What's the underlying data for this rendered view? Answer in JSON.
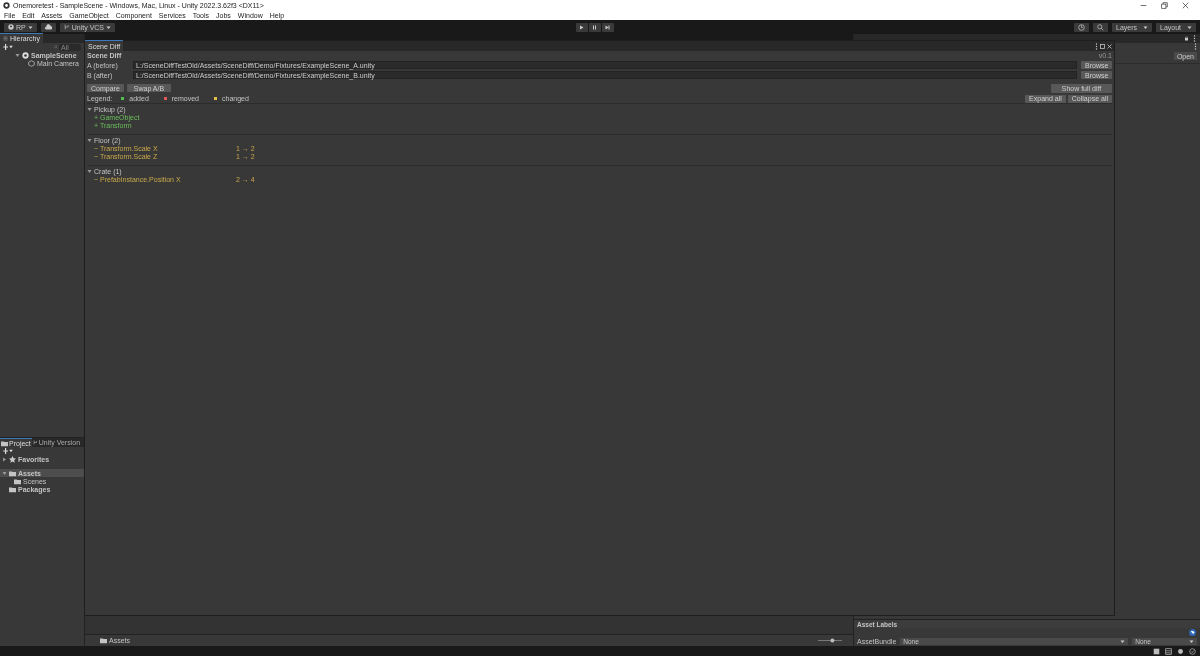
{
  "window": {
    "title": "Onemoretest - SampleScene - Windows, Mac, Linux - Unity 2022.3.62f3 <DX11>"
  },
  "menu": [
    "File",
    "Edit",
    "Assets",
    "GameObject",
    "Component",
    "Services",
    "Tools",
    "Jobs",
    "Window",
    "Help"
  ],
  "toolbar": {
    "account": "RP",
    "vcs": "Unity VCS",
    "layers": "Layers",
    "layout": "Layout"
  },
  "hierarchy": {
    "title": "Hierarchy",
    "search_placeholder": "All",
    "items": [
      {
        "label": "SampleScene",
        "expanded": true,
        "children": [
          {
            "label": "Main Camera"
          }
        ]
      }
    ]
  },
  "project": {
    "tabs": [
      {
        "label": "Project",
        "selected": true
      },
      {
        "label": "Unity Version",
        "selected": false
      }
    ],
    "tree": [
      {
        "label": "Favorites",
        "kind": "favorites",
        "expanded": false,
        "selected": false
      },
      {
        "label": "Assets",
        "kind": "folder",
        "expanded": true,
        "selected": true,
        "children": [
          {
            "label": "Scenes",
            "kind": "folder",
            "selected": false
          }
        ]
      },
      {
        "label": "Packages",
        "kind": "folder",
        "selected": false
      }
    ],
    "breadcrumb": "Assets",
    "zoom": {
      "level": 0.62
    }
  },
  "inspector": {
    "open_button": "Open",
    "asset_labels": "Asset Labels",
    "asset_bundle_label": "AssetBundle",
    "bundle": "None",
    "variant": "None"
  },
  "scene_diff": {
    "tab": "Scene Diff",
    "heading": "Scene Diff",
    "version": "v0.1",
    "paths": [
      {
        "label": "A (before)",
        "value": "L:/SceneDiffTestOld/Assets/SceneDiff/Demo/Fixtures/ExampleScene_A.unity",
        "button": "Browse"
      },
      {
        "label": "B (after)",
        "value": "L:/SceneDiffTestOld/Assets/SceneDiff/Demo/Fixtures/ExampleScene_B.unity",
        "button": "Browse"
      }
    ],
    "compare": "Compare",
    "swap": "Swap A/B",
    "show_full_diff": "Show full diff",
    "expand_all": "Expand all",
    "collapse_all": "Collapse all",
    "legend": {
      "label": "Legend:",
      "items": [
        {
          "label": "added",
          "color": "#4fbf4f"
        },
        {
          "label": "removed",
          "color": "#e05858"
        },
        {
          "label": "changed",
          "color": "#e0c040"
        }
      ]
    },
    "groups": [
      {
        "name": "Pickup",
        "count": "(2)",
        "expanded": true,
        "changes": [
          {
            "kind": "added",
            "text": "+ GameObject"
          },
          {
            "kind": "added",
            "text": "+ Transform"
          }
        ]
      },
      {
        "name": "Floor",
        "count": "(2)",
        "expanded": true,
        "changes": [
          {
            "kind": "changed",
            "text": "~ Transform.Scale X",
            "delta": "1 → 2"
          },
          {
            "kind": "changed",
            "text": "~ Transform.Scale Z",
            "delta": "1 → 2"
          }
        ]
      },
      {
        "name": "Crate",
        "count": "(1)",
        "expanded": true,
        "changes": [
          {
            "kind": "changed",
            "text": "~ PrefabInstance.Position X",
            "delta": "2 → 4"
          }
        ]
      }
    ]
  }
}
